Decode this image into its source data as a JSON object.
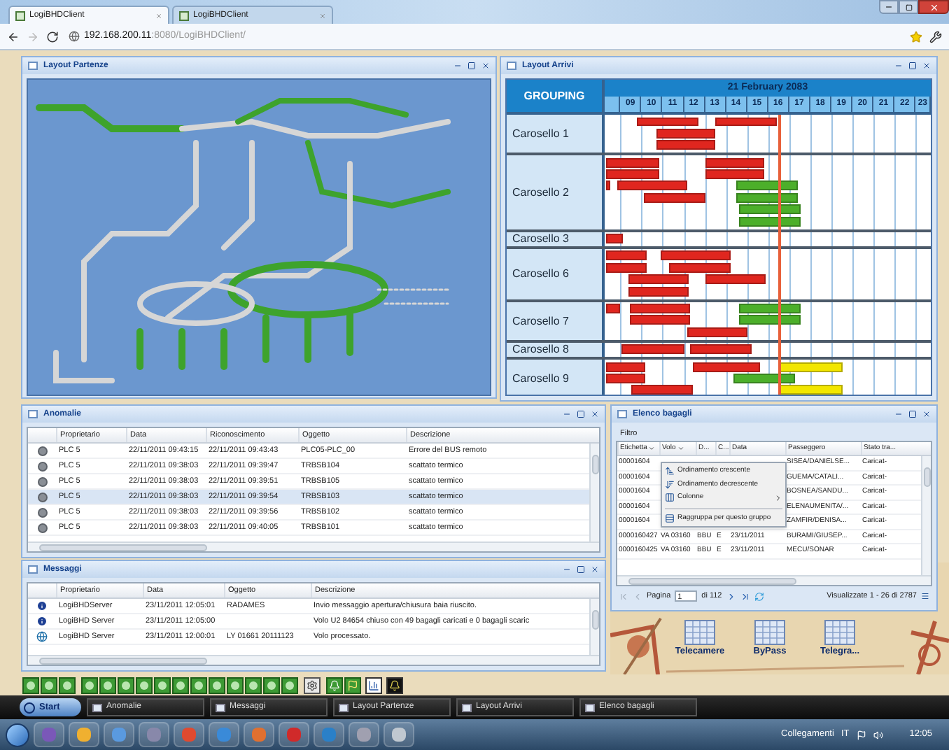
{
  "browser": {
    "tabs": [
      {
        "title": "LogiBHDClient",
        "selected": true
      },
      {
        "title": "LogiBHDClient",
        "selected": false
      }
    ],
    "address": {
      "host": "192.168.200.11",
      "path": ":8080/LogiBHDClient/"
    }
  },
  "layout_partenze": {
    "title": "Layout Partenze"
  },
  "layout_arrivi": {
    "title": "Layout Arrivi",
    "grouping_header": "GROUPING",
    "date": "21 February 2083",
    "hours": [
      "09",
      "10",
      "11",
      "12",
      "13",
      "14",
      "15",
      "16",
      "17",
      "18",
      "19",
      "20",
      "21",
      "22",
      "23"
    ],
    "groups": [
      {
        "name": "Carosello 1",
        "lanes": [
          [
            {
              "color": "#e0261f"
            },
            {
              "color": "#e0261f"
            }
          ],
          [
            {
              "color": "#e0261f"
            }
          ],
          [
            {
              "color": "#e0261f"
            }
          ]
        ]
      },
      {
        "name": "Carosello 2",
        "lanes": [
          [
            {
              "color": "#e0261f"
            },
            {
              "color": "#e0261f"
            }
          ],
          [
            {
              "color": "#e0261f"
            },
            {
              "color": "#e0261f"
            }
          ],
          [
            {
              "color": "#e0261f"
            },
            {
              "color": "#e0261f"
            },
            {
              "color": "#4caf2a"
            }
          ],
          [
            {
              "color": "#e0261f"
            },
            {
              "color": "#4caf2a"
            }
          ],
          [
            {
              "color": "#4caf2a"
            }
          ],
          [
            {
              "color": "#4caf2a"
            }
          ]
        ]
      },
      {
        "name": "Carosello 3",
        "lanes": [
          [
            {
              "color": "#e0261f"
            }
          ]
        ]
      },
      {
        "name": "Carosello 6",
        "lanes": [
          [
            {
              "color": "#e0261f"
            },
            {
              "color": "#e0261f"
            }
          ],
          [
            {
              "color": "#e0261f"
            },
            {
              "color": "#e0261f"
            }
          ],
          [
            {
              "color": "#e0261f"
            },
            {
              "color": "#e0261f"
            }
          ],
          [
            {
              "color": "#e0261f"
            }
          ]
        ]
      },
      {
        "name": "Carosello 7",
        "lanes": [
          [
            {
              "color": "#e0261f"
            },
            {
              "color": "#e0261f"
            },
            {
              "color": "#4caf2a"
            }
          ],
          [
            {
              "color": "#e0261f"
            },
            {
              "color": "#4caf2a"
            }
          ],
          [
            {
              "color": "#e0261f"
            }
          ]
        ]
      },
      {
        "name": "Carosello 8",
        "lanes": [
          [
            {
              "color": "#e0261f"
            },
            {
              "color": "#e0261f"
            }
          ]
        ]
      },
      {
        "name": "Carosello 9",
        "lanes": [
          [
            {
              "color": "#e0261f"
            },
            {
              "color": "#e0261f"
            },
            {
              "color": "#f2e600"
            }
          ],
          [
            {
              "color": "#e0261f"
            },
            {
              "color": "#4caf2a"
            }
          ],
          [
            {
              "color": "#e0261f"
            },
            {
              "color": "#f2e600"
            }
          ]
        ]
      }
    ]
  },
  "anomalie": {
    "title": "Anomalie",
    "columns": [
      "Proprietario",
      "Data",
      "Riconoscimento",
      "Oggetto",
      "Descrizione"
    ],
    "rows": [
      {
        "cells": [
          "PLC 5",
          "22/11/2011 09:43:15",
          "22/11/2011 09:43:43",
          "PLC05-PLC_00",
          "Errore del BUS remoto"
        ],
        "selected": false
      },
      {
        "cells": [
          "PLC 5",
          "22/11/2011 09:38:03",
          "22/11/2011 09:39:47",
          "TRBSB104",
          "scattato termico"
        ],
        "selected": false
      },
      {
        "cells": [
          "PLC 5",
          "22/11/2011 09:38:03",
          "22/11/2011 09:39:51",
          "TRBSB105",
          "scattato termico"
        ],
        "selected": false
      },
      {
        "cells": [
          "PLC 5",
          "22/11/2011 09:38:03",
          "22/11/2011 09:39:54",
          "TRBSB103",
          "scattato termico"
        ],
        "selected": true
      },
      {
        "cells": [
          "PLC 5",
          "22/11/2011 09:38:03",
          "22/11/2011 09:39:56",
          "TRBSB102",
          "scattato termico"
        ],
        "selected": false
      },
      {
        "cells": [
          "PLC 5",
          "22/11/2011 09:38:03",
          "22/11/2011 09:40:05",
          "TRBSB101",
          "scattato termico"
        ],
        "selected": false
      }
    ]
  },
  "elenco_bagagli": {
    "title": "Elenco bagagli",
    "filter_label": "Filtro",
    "columns": [
      "Etichetta",
      "Volo",
      "D...",
      "C...",
      "Data",
      "Passeggero",
      "Stato tra..."
    ],
    "rows": [
      {
        "etichetta": "00001604",
        "passeggero": "SISEA/DANIELSE...",
        "stato": "Caricat-"
      },
      {
        "etichetta": "00001604",
        "passeggero": "GUEMA/CATALI...",
        "stato": "Caricat-"
      },
      {
        "etichetta": "00001604",
        "passeggero": "BOSNEA/SANDU...",
        "stato": "Caricat-"
      },
      {
        "etichetta": "00001604",
        "passeggero": "ELENAUMENITA/...",
        "stato": "Caricat-"
      },
      {
        "etichetta": "00001604",
        "passeggero": "ZAMFIR/DENISA...",
        "stato": "Caricat-"
      },
      {
        "etichetta": "0000160427",
        "volo": "VA 03160",
        "d": "BBU",
        "c": "E",
        "data": "23/11/2011",
        "passeggero": "BURAMI/GIUSEP...",
        "stato": "Caricat-"
      },
      {
        "etichetta": "0000160425",
        "volo": "VA 03160",
        "d": "BBU",
        "c": "E",
        "data": "23/11/2011",
        "passeggero": "MECU/SONAR",
        "stato": "Caricat-"
      }
    ],
    "menu": [
      {
        "label": "Ordinamento crescente",
        "kind": "sort_asc"
      },
      {
        "label": "Ordinamento decrescente",
        "kind": "sort_desc"
      },
      {
        "label": "Colonne",
        "kind": "submenu"
      },
      {
        "label": "Raggruppa per questo gruppo",
        "kind": "group"
      }
    ],
    "pager": {
      "page_label": "Pagina",
      "page": "1",
      "of": "di 112",
      "summary": "Visualizzate 1 - 26 di 2787"
    }
  },
  "messaggi": {
    "title": "Messaggi",
    "columns": [
      "Proprietario",
      "Data",
      "Oggetto",
      "Descrizione"
    ],
    "rows": [
      {
        "kind": "info",
        "proprietario": "LogiBHDServer",
        "data": "23/11/2011 12:05:01",
        "oggetto": "RADAMES",
        "descrizione": "Invio messaggio apertura/chiusura baia riuscito."
      },
      {
        "kind": "info",
        "proprietario": "LogiBHD Server",
        "data": "23/11/2011 12:05:00",
        "descrizione": "Volo U2 84654 chiuso con 49 bagagli caricati e 0 bagagli scaric"
      },
      {
        "kind": "globe",
        "proprietario": "LogiBHD Server",
        "data": "23/11/2011 12:00:01",
        "oggetto": "LY 01661 20111123",
        "descrizione": "Volo processato."
      }
    ]
  },
  "desktop_icons": [
    "Telecamere",
    "ByPass",
    "Telegra..."
  ],
  "app_taskbar": {
    "start": "Start",
    "tasks": [
      "Anomalie",
      "Messaggi",
      "Layout Partenze",
      "Layout Arrivi",
      "Elenco bagagli"
    ]
  },
  "os_taskbar": {
    "links": "Collegamenti",
    "language": "IT",
    "clock": "12:05"
  }
}
